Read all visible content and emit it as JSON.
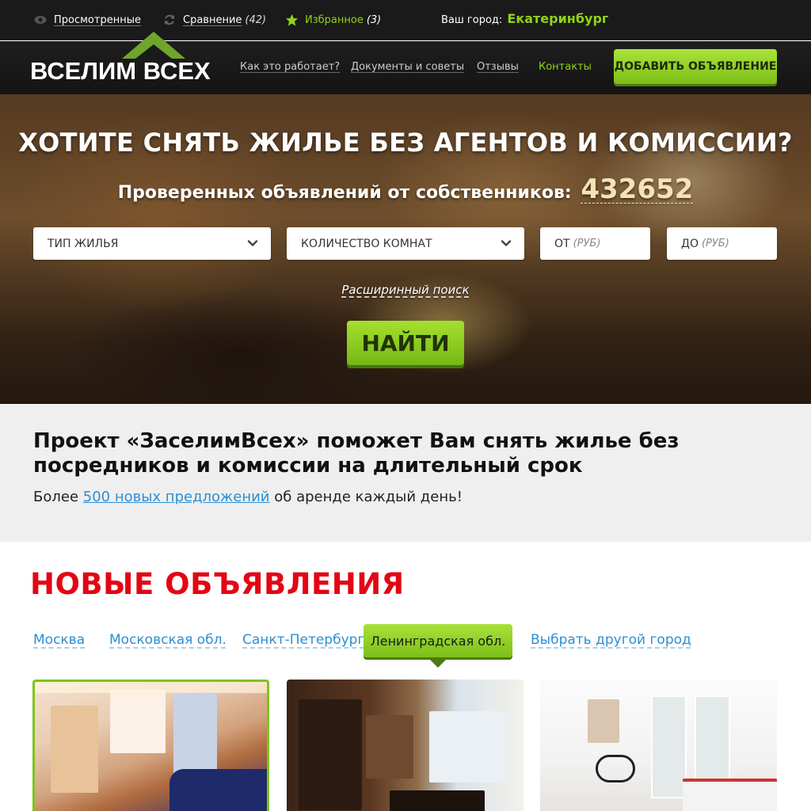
{
  "topbar": {
    "viewed_label": "Просмотренные",
    "compare_label": "Сравнение",
    "compare_count": "(42)",
    "favorites_label": "Избранное",
    "favorites_count": "(3)",
    "city_label": "Ваш город:",
    "city_value": "Екатеринбург"
  },
  "nav": {
    "logo_text": "ВСЕЛИМ ВСЕХ",
    "links": [
      "Как это работает?",
      "Документы и советы",
      "Отзывы",
      "Контакты"
    ],
    "add_button": "Добавить объявление"
  },
  "hero": {
    "title": "ХОТИТЕ СНЯТЬ ЖИЛЬЕ БЕЗ АГЕНТОВ И КОМИССИИ?",
    "subtitle": "Проверенных объявлений от собственников:",
    "count": "432652",
    "fields": {
      "type": "ТИП ЖИЛЬЯ",
      "rooms": "КОЛИЧЕСТВО КОМНАТ",
      "from": "ОТ",
      "from_unit": "(РУБ)",
      "to": "ДО",
      "to_unit": "(РУБ)"
    },
    "advanced_search": "Расширинный поиск",
    "find_button": "НАЙТИ"
  },
  "intro": {
    "heading": "Проект «ЗаселимВсех» поможет Вам снять жилье без посредников и комиссии на длительный срок",
    "text_before": "Более",
    "text_link": "500 новых предложений",
    "text_after": "об аренде каждый день!"
  },
  "listings": {
    "title": "НОВЫЕ ОБЪЯВЛЕНИЯ",
    "tabs": [
      "Москва",
      "Московская обл.",
      "Санкт-Петербург",
      "Ленинградская обл.",
      "Выбрать другой город"
    ],
    "active_tab": "Ленинградская обл."
  },
  "colors": {
    "accent_green": "#8fd319",
    "title_red": "#e30613",
    "link_blue": "#2d8fd4"
  }
}
